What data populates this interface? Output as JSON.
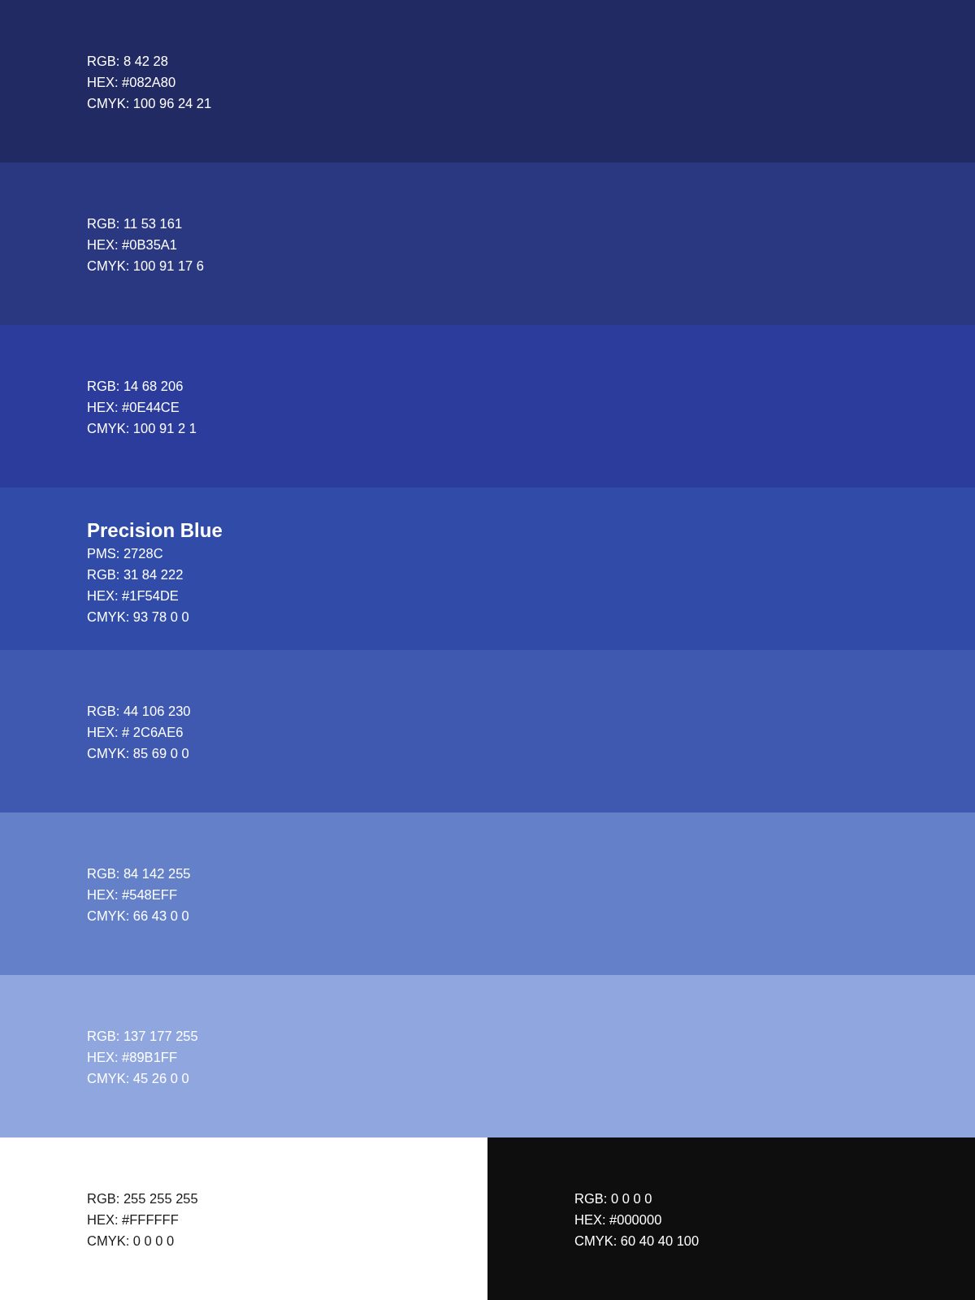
{
  "rows": [
    {
      "swatches": [
        {
          "color": "#222a63",
          "lines": [
            "RGB: 8 42 28",
            "HEX: #082A80",
            "CMYK: 100 96 24 21"
          ]
        }
      ]
    },
    {
      "swatches": [
        {
          "color": "#2a3882",
          "lines": [
            "RGB: 11 53 161",
            "HEX: #0B35A1",
            "CMYK: 100 91 17 6"
          ]
        }
      ]
    },
    {
      "swatches": [
        {
          "color": "#2b3c9c",
          "lines": [
            "RGB: 14 68 206",
            "HEX: #0E44CE",
            "CMYK: 100 91 2 1"
          ]
        }
      ]
    },
    {
      "swatches": [
        {
          "color": "#304ca8",
          "title": "Precision Blue",
          "lines": [
            "PMS: 2728C",
            "RGB: 31 84 222",
            "HEX: #1F54DE",
            "CMYK: 93 78 0 0"
          ]
        }
      ]
    },
    {
      "swatches": [
        {
          "color": "#3f58b0",
          "lines": [
            "RGB: 44 106 230",
            "HEX: # 2C6AE6",
            "CMYK: 85 69 0 0"
          ]
        }
      ]
    },
    {
      "swatches": [
        {
          "color": "#6380c8",
          "lines": [
            "RGB: 84 142 255",
            "HEX: #548EFF",
            "CMYK: 66 43 0 0"
          ]
        }
      ]
    },
    {
      "swatches": [
        {
          "color": "#8fa6de",
          "lines": [
            "RGB: 137 177 255",
            "HEX: #89B1FF",
            "CMYK: 45 26 0 0"
          ]
        }
      ]
    },
    {
      "swatches": [
        {
          "color": "#ffffff",
          "lines": [
            "RGB: 255 255 255",
            "HEX: #FFFFFF",
            "CMYK: 0 0 0 0"
          ]
        },
        {
          "color": "#0e0e0e",
          "lines": [
            "RGB: 0 0 0 0",
            "HEX: #000000",
            "CMYK: 60 40 40 100"
          ]
        }
      ]
    }
  ]
}
